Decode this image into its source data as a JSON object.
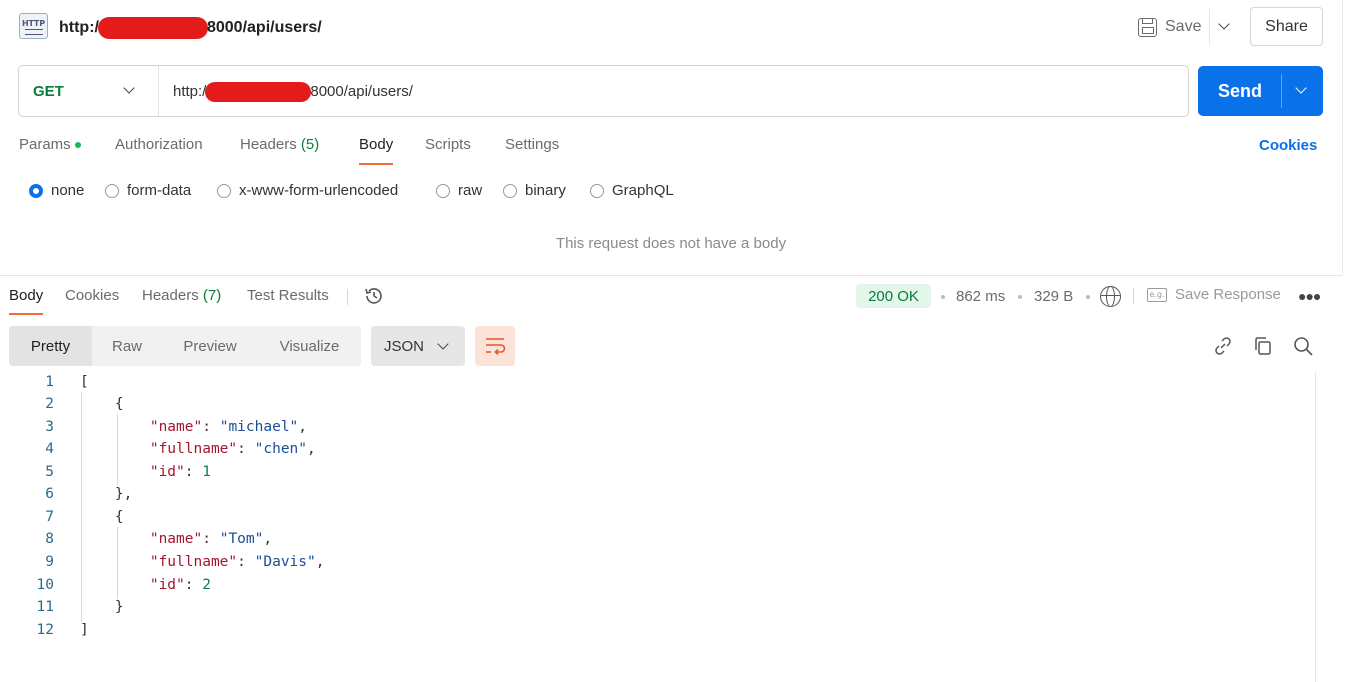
{
  "header": {
    "url_prefix": "http:/",
    "url_suffix": "8000/api/users/",
    "save_label": "Save",
    "share_label": "Share",
    "icon": "http-request-icon"
  },
  "request": {
    "method": "GET",
    "url_prefix": "http:/",
    "url_suffix": "8000/api/users/",
    "send_label": "Send",
    "tabs": [
      {
        "label": "Params",
        "indicator": "green-dot"
      },
      {
        "label": "Authorization"
      },
      {
        "label": "Headers",
        "count": "(5)"
      },
      {
        "label": "Body",
        "active": true
      },
      {
        "label": "Scripts"
      },
      {
        "label": "Settings"
      }
    ],
    "cookies_label": "Cookies",
    "body_types": [
      "none",
      "form-data",
      "x-www-form-urlencoded",
      "raw",
      "binary",
      "GraphQL"
    ],
    "selected_body_type": "none",
    "empty_message": "This request does not have a body"
  },
  "response": {
    "tabs": [
      {
        "label": "Body",
        "active": true
      },
      {
        "label": "Cookies"
      },
      {
        "label": "Headers",
        "count": "(7)"
      },
      {
        "label": "Test Results"
      }
    ],
    "status": "200 OK",
    "time": "862 ms",
    "size": "329 B",
    "save_response_label": "Save Response",
    "views": [
      "Pretty",
      "Raw",
      "Preview",
      "Visualize"
    ],
    "active_view": "Pretty",
    "format": "JSON",
    "line_numbers": [
      "1",
      "2",
      "3",
      "4",
      "5",
      "6",
      "7",
      "8",
      "9",
      "10",
      "11",
      "12"
    ],
    "users": [
      {
        "name": "michael",
        "fullname": "chen",
        "id": "1"
      },
      {
        "name": "Tom",
        "fullname": "Davis",
        "id": "2"
      }
    ],
    "keys": {
      "name": "\"name\"",
      "fullname": "\"fullname\"",
      "id": "\"id\""
    }
  },
  "colors": {
    "accent": "#0a72e8",
    "method_get": "#0a7d3b",
    "active_tab_underline": "#f26b3a",
    "status_ok_bg": "#e3f6ea",
    "redaction": "#e31b1b"
  }
}
